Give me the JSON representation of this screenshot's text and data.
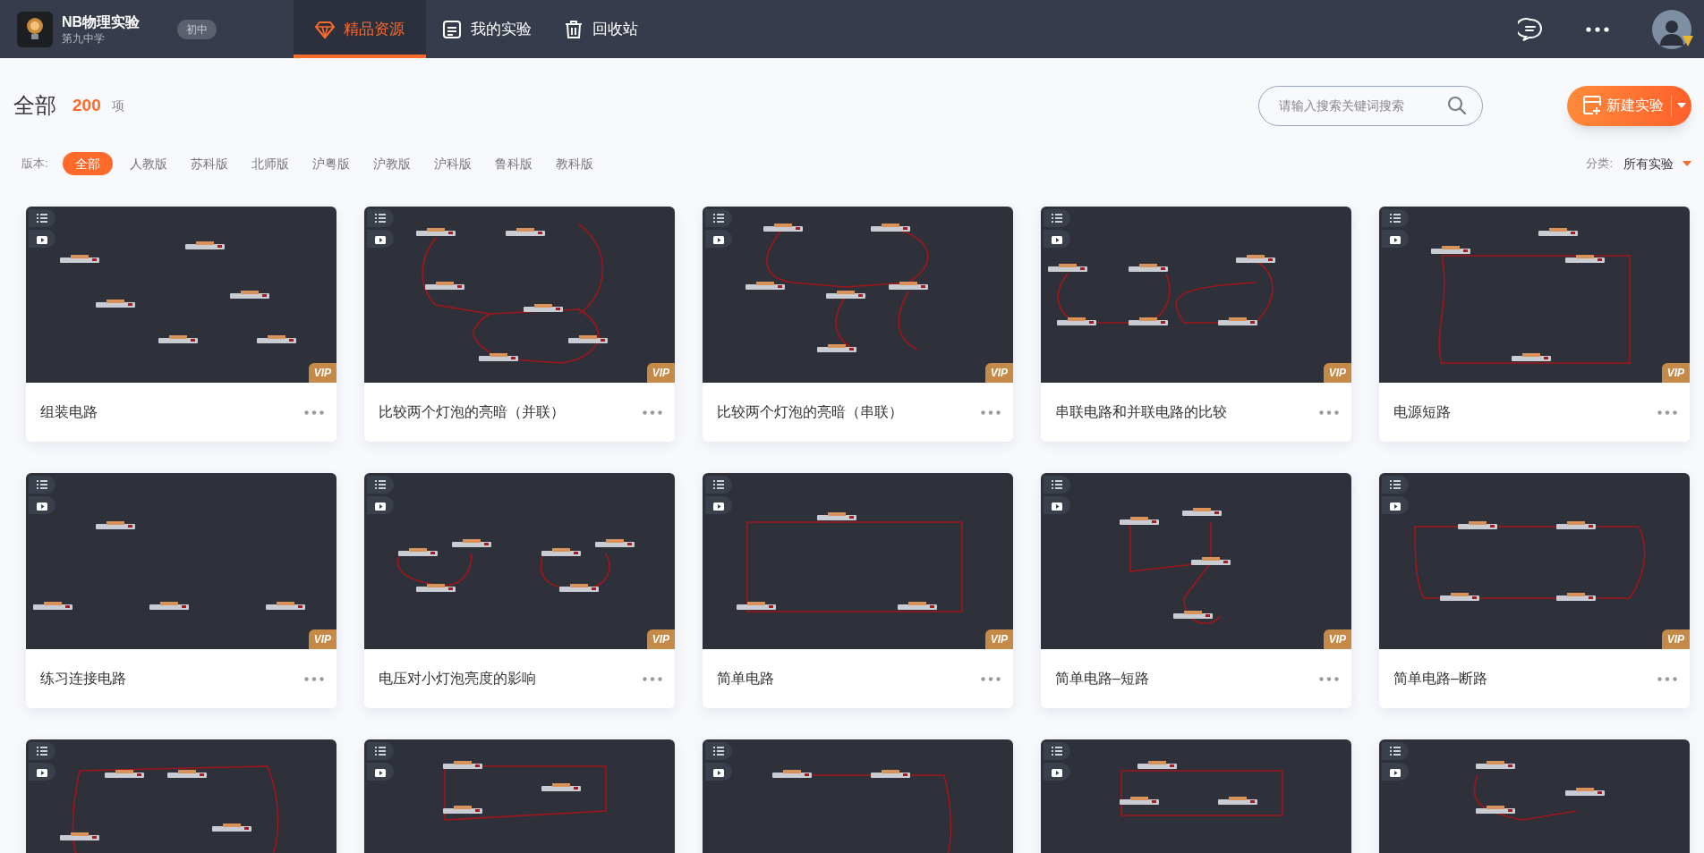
{
  "header": {
    "app_title": "NB物理实验",
    "school": "第九中学",
    "grade_badge": "初中",
    "nav": [
      {
        "label": "精品资源",
        "selected": true
      },
      {
        "label": "我的实验",
        "selected": false
      },
      {
        "label": "回收站",
        "selected": false
      }
    ]
  },
  "toolbar": {
    "heading": "全部",
    "count": "200",
    "unit": "项",
    "search": {
      "placeholder": "请输入搜索关键词搜索"
    },
    "new_button": "新建实验"
  },
  "filters": {
    "label": "版本:",
    "options": [
      {
        "label": "全部",
        "selected": true
      },
      {
        "label": "人教版",
        "selected": false
      },
      {
        "label": "苏科版",
        "selected": false
      },
      {
        "label": "北师版",
        "selected": false
      },
      {
        "label": "沪粤版",
        "selected": false
      },
      {
        "label": "沪教版",
        "selected": false
      },
      {
        "label": "沪科版",
        "selected": false
      },
      {
        "label": "鲁科版",
        "selected": false
      },
      {
        "label": "教科版",
        "selected": false
      }
    ],
    "category_label": "分类:",
    "category_value": "所有实验"
  },
  "experiments": [
    {
      "title": "组装电路",
      "badge": "VIP",
      "wired": false
    },
    {
      "title": "比较两个灯泡的亮暗（并联）",
      "badge": "VIP",
      "wired": true
    },
    {
      "title": "比较两个灯泡的亮暗（串联）",
      "badge": "VIP",
      "wired": true
    },
    {
      "title": "串联电路和并联电路的比较",
      "badge": "VIP",
      "wired": true
    },
    {
      "title": "电源短路",
      "badge": "VIP",
      "wired": true
    },
    {
      "title": "练习连接电路",
      "badge": "VIP",
      "wired": false
    },
    {
      "title": "电压对小灯泡亮度的影响",
      "badge": "VIP",
      "wired": true
    },
    {
      "title": "简单电路",
      "badge": "VIP",
      "wired": true
    },
    {
      "title": "简单电路–短路",
      "badge": "VIP",
      "wired": true
    },
    {
      "title": "简单电路–断路",
      "badge": "VIP",
      "wired": true
    },
    {
      "wired": true
    },
    {
      "wired": true
    },
    {
      "wired": true
    },
    {
      "wired": true
    },
    {
      "wired": true
    }
  ]
}
